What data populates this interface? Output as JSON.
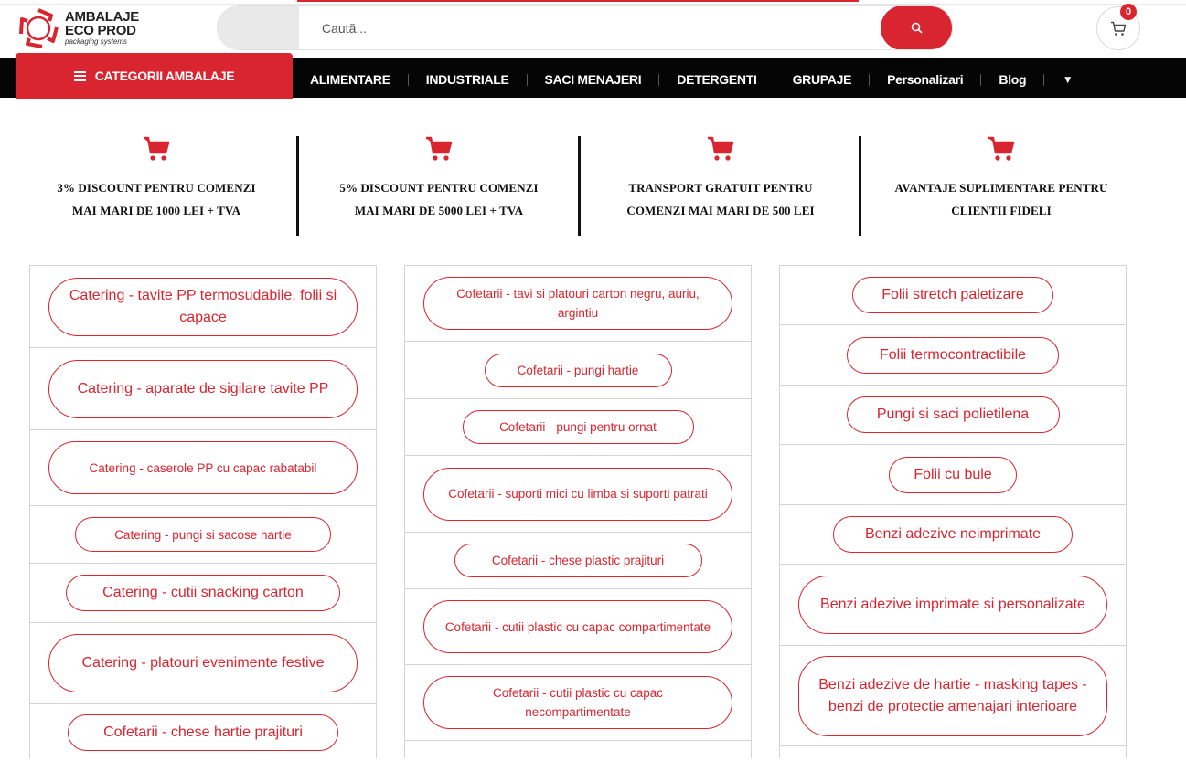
{
  "brand": {
    "line1": "AMBALAJE",
    "line2": "ECO PROD",
    "tagline": "packaging systems",
    "color": "#d9252f"
  },
  "search": {
    "placeholder": "Caută..."
  },
  "cart": {
    "count": "0"
  },
  "nav": {
    "categories_label": "CATEGORII AMBALAJE",
    "items": [
      "ALIMENTARE",
      "INDUSTRIALE",
      "SACI MENAJERI",
      "DETERGENTI",
      "GRUPAJE",
      "Personalizari",
      "Blog"
    ]
  },
  "features": [
    {
      "line1": "3% DISCOUNT PENTRU COMENZI",
      "line2": "MAI MARI DE 1000 LEI + TVA",
      "icon": "cart-icon"
    },
    {
      "line1": "5% DISCOUNT PENTRU COMENZI",
      "line2": "MAI MARI DE 5000 LEI + TVA",
      "icon": "cart-icon"
    },
    {
      "line1": "TRANSPORT GRATUIT PENTRU",
      "line2": "COMENZI MAI MARI DE 500 LEI",
      "icon": "cart-icon"
    },
    {
      "line1": "AVANTAJE SUPLIMENTARE PENTRU",
      "line2": "CLIENTII FIDELI",
      "icon": "cart-icon"
    }
  ],
  "columns": [
    [
      "Catering - tavite PP termosudabile, folii si capace",
      "Catering - aparate de sigilare tavite PP",
      "Catering - caserole PP cu capac rabatabil",
      "Catering - pungi si sacose hartie",
      "Catering - cutii snacking carton",
      "Catering - platouri evenimente festive",
      "Cofetarii - chese hartie prajituri"
    ],
    [
      "Cofetarii - tavi si platouri carton negru, auriu, argintiu",
      "Cofetarii - pungi hartie",
      "Cofetarii - pungi pentru ornat",
      "Cofetarii - suporti mici cu limba si suporti patrati",
      "Cofetarii - chese plastic prajituri",
      "Cofetarii - cutii plastic cu capac compartimentate",
      "Cofetarii - cutii plastic cu capac necompartimentate"
    ],
    [
      "Folii stretch paletizare",
      "Folii termocontractibile",
      "Pungi si saci polietilena",
      "Folii cu bule",
      "Benzi adezive neimprimate",
      "Benzi adezive imprimate si personalizate",
      "Benzi adezive de hartie - masking tapes - benzi de protectie amenajari interioare"
    ]
  ]
}
